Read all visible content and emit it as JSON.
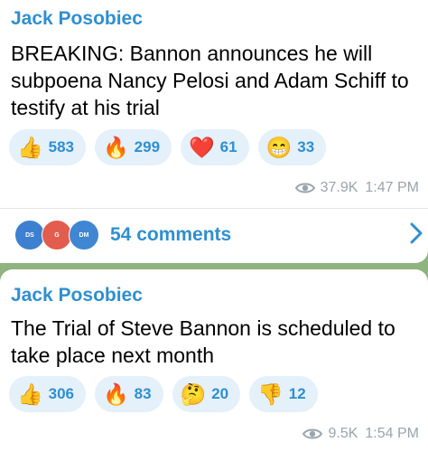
{
  "posts": [
    {
      "author": "Jack Posobiec",
      "text": "BREAKING: Bannon announces he will subpoena Nancy Pelosi and Adam Schiff to testify at his trial",
      "reactions": [
        {
          "emoji": "👍",
          "icon": "thumbs-up",
          "count": "583"
        },
        {
          "emoji": "🔥",
          "icon": "fire",
          "count": "299"
        },
        {
          "emoji": "❤️",
          "icon": "heart",
          "count": "61"
        },
        {
          "emoji": "😁",
          "icon": "grin",
          "count": "33"
        }
      ],
      "views": "37.9K",
      "time": "1:47 PM",
      "comments": {
        "label": "54 comments",
        "avatars": [
          {
            "initials": "DS",
            "color": "#3d7fd0"
          },
          {
            "initials": "G",
            "color": "#e25d4d"
          },
          {
            "initials": "DM",
            "color": "#3f86d3"
          }
        ]
      }
    },
    {
      "author": "Jack Posobiec",
      "text": "The Trial of Steve Bannon is scheduled to take place next month",
      "reactions": [
        {
          "emoji": "👍",
          "icon": "thumbs-up",
          "count": "306"
        },
        {
          "emoji": "🔥",
          "icon": "fire",
          "count": "83"
        },
        {
          "emoji": "🤔",
          "icon": "thinking",
          "count": "20"
        },
        {
          "emoji": "👎",
          "icon": "thumbs-down",
          "count": "12"
        }
      ],
      "views": "9.5K",
      "time": "1:54 PM"
    }
  ],
  "colors": {
    "accent": "#2f8fd0",
    "reaction_bg": "#e4f0fa",
    "meta": "#9aa4ad",
    "chat_bg": "#8fb37f"
  }
}
